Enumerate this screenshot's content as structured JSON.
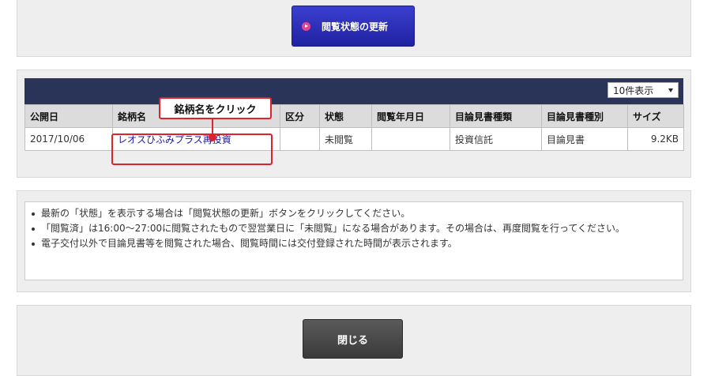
{
  "toolbar": {
    "update_label": "閲覧状態の更新",
    "update_icon": "play-circle-icon",
    "close_label": "閉じる"
  },
  "table": {
    "display_select": {
      "selected": "10件表示"
    },
    "headers": [
      "公開日",
      "銘柄名",
      "区分",
      "状態",
      "閲覧年月日",
      "目論見書種類",
      "目論見書種別",
      "サイズ"
    ],
    "rows": [
      {
        "date": "2017/10/06",
        "name": "レオスひふみプラス再投資",
        "division": "",
        "status": "未閲覧",
        "viewed_date": "",
        "doc_type": "投資信託",
        "doc_kind": "目論見書",
        "size": "9.2KB"
      }
    ]
  },
  "annotation": {
    "callout": "銘柄名をクリック",
    "color": "#e0232a"
  },
  "notes": [
    "最新の「状態」を表示する場合は「閲覧状態の更新」ボタンをクリックしてください。",
    "「閲覧済」は16:00〜27:00に閲覧されたもので翌営業日に「未閲覧」になる場合があります。その場合は、再度閲覧を行ってください。",
    "電子交付以外で目論見書等を閲覧された場合、閲覧時間には交付登録された時間が表示されます。"
  ],
  "colors": {
    "header_bar": "#2a3358",
    "update_button": "#2a2db8",
    "close_button": "#444444",
    "link": "#1a1aa6"
  }
}
